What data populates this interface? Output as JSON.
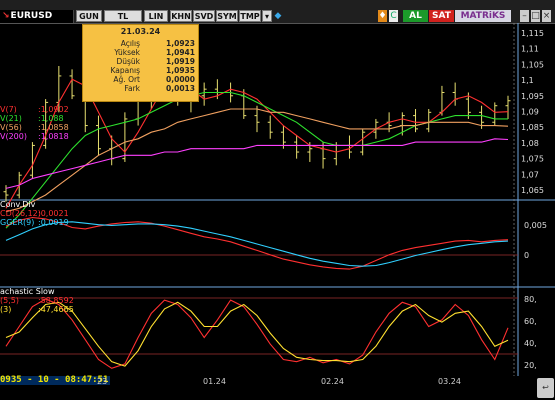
{
  "toolbar": {
    "symbol": "EURUSD",
    "buttons": [
      "GUN",
      "TL",
      "LIN",
      "KHN",
      "SVD",
      "SYM",
      "TMP"
    ],
    "buy_label": "AL",
    "sell_label": "SAT",
    "brand": "MATRiKS",
    "colors": {
      "buy": "#1b9a2a",
      "sell": "#d1211d",
      "brand_bg": "#d8d8e4"
    }
  },
  "tooltip": {
    "date": "21.03.24",
    "rows": [
      {
        "label": "Açılış",
        "value": "1,0923"
      },
      {
        "label": "Yüksek",
        "value": "1,0941"
      },
      {
        "label": "Düşük",
        "value": "1,0919"
      },
      {
        "label": "Kapanış",
        "value": "1,0935"
      },
      {
        "label": "Ağ. Ort",
        "value": "0,0000"
      },
      {
        "label": "Fark",
        "value": "0,0013"
      }
    ]
  },
  "legends": {
    "price": [
      {
        "label": "V(7)",
        "value": ":1,0902",
        "color": "#ff3030"
      },
      {
        "label": "V(21)",
        "value": ":1,088",
        "color": "#2ee02e"
      },
      {
        "label": "V(56)",
        "value": ":1,0858",
        "color": "#f0a060"
      },
      {
        "label": "V(200)",
        "value": ":1,0818",
        "color": "#ff40ff"
      }
    ],
    "macd": [
      {
        "label": "Conv.Div",
        "value": "",
        "color": "#ffffff"
      },
      {
        "label": "CD(26,12)",
        "value": ":0,0021",
        "color": "#ff3030"
      },
      {
        "label": "GGER(9)",
        "value": ":0,0019",
        "color": "#30d0ff"
      }
    ],
    "stoch": [
      {
        "label": "achastic Slow",
        "value": "",
        "color": "#ffffff"
      },
      {
        "label": "(5,5)",
        "value": ":58,8592",
        "color": "#ff3030"
      },
      {
        "label": "(3)",
        "value": ":47,4665",
        "color": "#ffe030"
      }
    ]
  },
  "axes": {
    "price_ticks": [
      "1,115",
      "1,11",
      "1,105",
      "1,1",
      "1,095",
      "1,09",
      "1,085",
      "1,08",
      "1,075",
      "1,07",
      "1,065"
    ],
    "macd_ticks": [
      "0,005",
      "0"
    ],
    "stoch_ticks": [
      "80,",
      "60,",
      "40,",
      "20,"
    ]
  },
  "bottom": {
    "last_value": "0935 - 10 - 08:47:51",
    "dates": [
      "23",
      "01.24",
      "02.24",
      "03.24"
    ]
  },
  "chart_data": [
    {
      "type": "line",
      "title": "EURUSD",
      "ylim": [
        1.0635,
        1.117
      ],
      "series": [
        {
          "name": "V(7)",
          "values": [
            1.061,
            1.068,
            1.074,
            1.083,
            1.093,
            1.1,
            1.098,
            1.09,
            1.082,
            1.078,
            1.084,
            1.091,
            1.098,
            1.101,
            1.097,
            1.094,
            1.095,
            1.097,
            1.096,
            1.094,
            1.09,
            1.086,
            1.083,
            1.08,
            1.079,
            1.078,
            1.079,
            1.082,
            1.085,
            1.087,
            1.088,
            1.087,
            1.087,
            1.09,
            1.094,
            1.095,
            1.093,
            1.09,
            1.0902
          ]
        },
        {
          "name": "V(21)",
          "values": [
            1.055,
            1.059,
            1.064,
            1.069,
            1.074,
            1.079,
            1.083,
            1.085,
            1.086,
            1.087,
            1.088,
            1.09,
            1.092,
            1.094,
            1.095,
            1.096,
            1.096,
            1.096,
            1.095,
            1.093,
            1.091,
            1.089,
            1.087,
            1.084,
            1.081,
            1.08,
            1.08,
            1.08,
            1.081,
            1.082,
            1.084,
            1.086,
            1.087,
            1.088,
            1.089,
            1.089,
            1.089,
            1.088,
            1.088
          ]
        },
        {
          "name": "V(56)",
          "values": [
            1.06,
            1.061,
            1.063,
            1.065,
            1.068,
            1.071,
            1.074,
            1.077,
            1.079,
            1.081,
            1.082,
            1.084,
            1.085,
            1.087,
            1.088,
            1.089,
            1.09,
            1.091,
            1.091,
            1.091,
            1.09,
            1.09,
            1.089,
            1.088,
            1.087,
            1.086,
            1.085,
            1.085,
            1.085,
            1.085,
            1.086,
            1.086,
            1.087,
            1.087,
            1.087,
            1.087,
            1.086,
            1.086,
            1.0858
          ]
        },
        {
          "name": "V(200)",
          "values": [
            1.067,
            1.068,
            1.07,
            1.071,
            1.072,
            1.073,
            1.074,
            1.075,
            1.076,
            1.077,
            1.077,
            1.077,
            1.078,
            1.078,
            1.079,
            1.079,
            1.079,
            1.079,
            1.079,
            1.08,
            1.08,
            1.08,
            1.08,
            1.08,
            1.08,
            1.08,
            1.08,
            1.08,
            1.08,
            1.08,
            1.08,
            1.081,
            1.081,
            1.081,
            1.081,
            1.081,
            1.081,
            1.082,
            1.0818
          ]
        }
      ],
      "candles": [
        {
          "o": 1.066,
          "h": 1.068,
          "l": 1.063,
          "c": 1.065
        },
        {
          "o": 1.065,
          "h": 1.072,
          "l": 1.064,
          "c": 1.071
        },
        {
          "o": 1.071,
          "h": 1.081,
          "l": 1.07,
          "c": 1.08
        },
        {
          "o": 1.08,
          "h": 1.094,
          "l": 1.079,
          "c": 1.093
        },
        {
          "o": 1.093,
          "h": 1.104,
          "l": 1.09,
          "c": 1.101
        },
        {
          "o": 1.101,
          "h": 1.103,
          "l": 1.094,
          "c": 1.095
        },
        {
          "o": 1.095,
          "h": 1.097,
          "l": 1.084,
          "c": 1.086
        },
        {
          "o": 1.086,
          "h": 1.089,
          "l": 1.077,
          "c": 1.079
        },
        {
          "o": 1.079,
          "h": 1.083,
          "l": 1.074,
          "c": 1.076
        },
        {
          "o": 1.076,
          "h": 1.09,
          "l": 1.075,
          "c": 1.088
        },
        {
          "o": 1.088,
          "h": 1.096,
          "l": 1.086,
          "c": 1.094
        },
        {
          "o": 1.094,
          "h": 1.101,
          "l": 1.091,
          "c": 1.099
        },
        {
          "o": 1.099,
          "h": 1.104,
          "l": 1.095,
          "c": 1.1
        },
        {
          "o": 1.1,
          "h": 1.102,
          "l": 1.092,
          "c": 1.094
        },
        {
          "o": 1.094,
          "h": 1.097,
          "l": 1.09,
          "c": 1.095
        },
        {
          "o": 1.095,
          "h": 1.099,
          "l": 1.092,
          "c": 1.097
        },
        {
          "o": 1.097,
          "h": 1.1,
          "l": 1.094,
          "c": 1.096
        },
        {
          "o": 1.096,
          "h": 1.099,
          "l": 1.093,
          "c": 1.095
        },
        {
          "o": 1.095,
          "h": 1.097,
          "l": 1.088,
          "c": 1.089
        },
        {
          "o": 1.089,
          "h": 1.092,
          "l": 1.084,
          "c": 1.087
        },
        {
          "o": 1.087,
          "h": 1.089,
          "l": 1.082,
          "c": 1.084
        },
        {
          "o": 1.084,
          "h": 1.086,
          "l": 1.079,
          "c": 1.081
        },
        {
          "o": 1.081,
          "h": 1.083,
          "l": 1.076,
          "c": 1.078
        },
        {
          "o": 1.078,
          "h": 1.081,
          "l": 1.075,
          "c": 1.079
        },
        {
          "o": 1.079,
          "h": 1.081,
          "l": 1.073,
          "c": 1.076
        },
        {
          "o": 1.076,
          "h": 1.081,
          "l": 1.074,
          "c": 1.08
        },
        {
          "o": 1.08,
          "h": 1.083,
          "l": 1.076,
          "c": 1.078
        },
        {
          "o": 1.078,
          "h": 1.085,
          "l": 1.077,
          "c": 1.084
        },
        {
          "o": 1.084,
          "h": 1.088,
          "l": 1.082,
          "c": 1.087
        },
        {
          "o": 1.087,
          "h": 1.09,
          "l": 1.084,
          "c": 1.086
        },
        {
          "o": 1.086,
          "h": 1.09,
          "l": 1.083,
          "c": 1.089
        },
        {
          "o": 1.089,
          "h": 1.091,
          "l": 1.084,
          "c": 1.085
        },
        {
          "o": 1.085,
          "h": 1.091,
          "l": 1.084,
          "c": 1.09
        },
        {
          "o": 1.09,
          "h": 1.098,
          "l": 1.089,
          "c": 1.096
        },
        {
          "o": 1.096,
          "h": 1.099,
          "l": 1.092,
          "c": 1.094
        },
        {
          "o": 1.094,
          "h": 1.096,
          "l": 1.088,
          "c": 1.09
        },
        {
          "o": 1.09,
          "h": 1.092,
          "l": 1.085,
          "c": 1.087
        },
        {
          "o": 1.087,
          "h": 1.093,
          "l": 1.086,
          "c": 1.092
        },
        {
          "o": 1.092,
          "h": 1.095,
          "l": 1.088,
          "c": 1.0935
        }
      ]
    },
    {
      "type": "line",
      "title": "Conv.Div",
      "ylim": [
        -0.0045,
        0.0075
      ],
      "series": [
        {
          "name": "CD(26,12)",
          "values": [
            0.004,
            0.0048,
            0.0052,
            0.005,
            0.0045,
            0.0038,
            0.0036,
            0.004,
            0.0043,
            0.0045,
            0.0046,
            0.0044,
            0.004,
            0.0035,
            0.003,
            0.0025,
            0.0022,
            0.0018,
            0.0012,
            0.0006,
            0.0,
            -0.0006,
            -0.001,
            -0.0014,
            -0.0017,
            -0.0019,
            -0.002,
            -0.0016,
            -0.0008,
            0.0,
            0.0006,
            0.001,
            0.0013,
            0.0016,
            0.0019,
            0.002,
            0.0018,
            0.002,
            0.0021
          ]
        },
        {
          "name": "GGER(9)",
          "values": [
            0.002,
            0.0028,
            0.0036,
            0.0042,
            0.0045,
            0.0046,
            0.0044,
            0.0042,
            0.0041,
            0.0042,
            0.0043,
            0.0043,
            0.0042,
            0.004,
            0.0037,
            0.0033,
            0.0029,
            0.0025,
            0.002,
            0.0015,
            0.001,
            0.0005,
            0.0,
            -0.0005,
            -0.0009,
            -0.0012,
            -0.0015,
            -0.0016,
            -0.0015,
            -0.0011,
            -0.0006,
            -0.0001,
            0.0003,
            0.0007,
            0.0011,
            0.0014,
            0.0016,
            0.0018,
            0.0019
          ]
        }
      ]
    },
    {
      "type": "line",
      "title": "Stochastic Slow",
      "ylim": [
        15,
        95
      ],
      "series": [
        {
          "name": "(5,5)",
          "values": [
            42,
            60,
            78,
            85,
            80,
            66,
            48,
            30,
            22,
            26,
            50,
            72,
            84,
            80,
            68,
            50,
            66,
            84,
            78,
            62,
            44,
            30,
            28,
            32,
            27,
            30,
            26,
            34,
            55,
            72,
            82,
            78,
            60,
            66,
            80,
            70,
            48,
            30,
            58.86
          ]
        },
        {
          "name": "(3)",
          "values": [
            50,
            55,
            68,
            80,
            82,
            74,
            58,
            42,
            28,
            24,
            38,
            60,
            76,
            82,
            74,
            60,
            60,
            74,
            80,
            70,
            54,
            40,
            32,
            30,
            29,
            29,
            28,
            30,
            42,
            60,
            74,
            80,
            70,
            64,
            72,
            74,
            60,
            42,
            47.47
          ]
        }
      ]
    }
  ]
}
